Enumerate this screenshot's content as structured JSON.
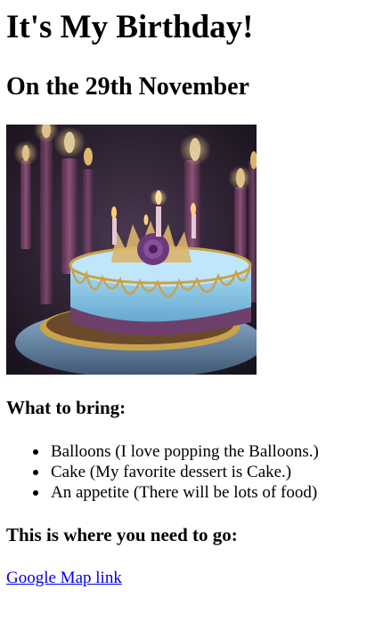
{
  "page": {
    "title": "It's My Birthday!",
    "subtitle": "On the 29th November"
  },
  "image": {
    "name": "birthday-cake-image",
    "colors": {
      "background": "#2a1f2e",
      "cake": "#7ec3e6",
      "gold": "#c9a24a",
      "flame": "#ffcf6a"
    }
  },
  "bring": {
    "heading": "What to bring:",
    "items": [
      "Balloons (I love popping the Balloons.)",
      "Cake (My favorite dessert is Cake.)",
      "An appetite (There will be lots of food)"
    ]
  },
  "location": {
    "heading": "This is where you need to go:",
    "link_text": "Google Map link",
    "link_color": "#0000ee"
  }
}
